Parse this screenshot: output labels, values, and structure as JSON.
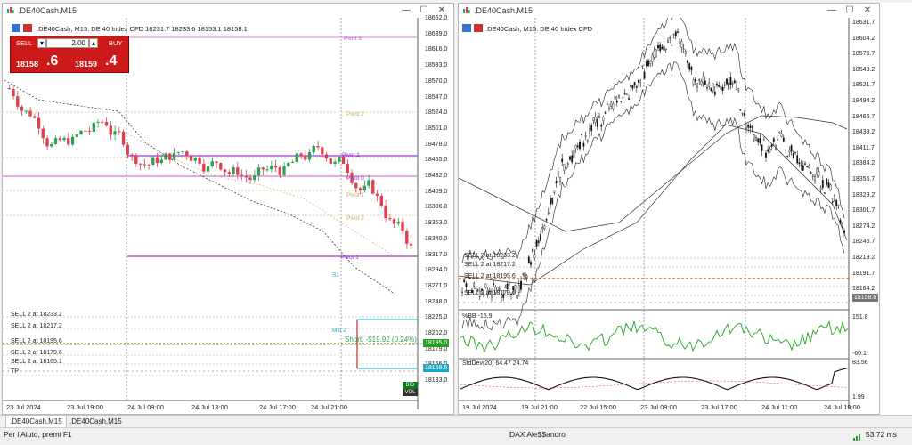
{
  "left_window": {
    "title": ".DE40Cash,M15",
    "chart_header": ".DE40Cash, M15:  DE 40 Index CFD  18231.7 18233.6 18153.1 18158.1",
    "trade_panel": {
      "sell_label": "SELL",
      "buy_label": "BUY",
      "volume": "2.00",
      "sell_price_main": "18158",
      "sell_price_big": ".6",
      "buy_price_main": "18159",
      "buy_price_big": ".4"
    },
    "price_axis": [
      "18662.0",
      "18639.0",
      "18616.0",
      "18593.0",
      "18570.0",
      "18547.0",
      "18524.0",
      "18501.0",
      "18478.0",
      "18455.0",
      "18432.0",
      "18409.0",
      "18386.0",
      "18363.0",
      "18340.0",
      "18317.0",
      "18294.0",
      "18271.0",
      "18248.0",
      "18225.0",
      "18202.0",
      "18179.0",
      "18156.0",
      "18133.0"
    ],
    "time_axis": [
      "23 Jul 2024",
      "23 Jul 19:00",
      "24 Jul 09:00",
      "24 Jul 13:00",
      "24 Jul 17:00",
      "24 Jul 21:00"
    ],
    "level_labels": [
      "Pivot 3",
      "Pivot 2",
      "Pivot 1",
      "Pivot 0",
      "Pivot 1",
      "Pivot 2",
      "Pivot 1",
      "S1",
      "Mid 2"
    ],
    "orders": [
      "SELL 2 at 18233.2",
      "SELL 2 at 18217.2",
      "SELL 2 at 18195.6",
      "SELL 2 at 18179.6",
      "SELL 2 at 18165.1",
      "TP"
    ],
    "short_text": "Short: -$19.92 (0.24%)",
    "price_box_green": "18195.0",
    "price_box_teal": "18158.6",
    "small_buttons": [
      "BID",
      "VOL"
    ]
  },
  "right_window": {
    "title": ".DE40Cash,M15",
    "chart_header": ".DE40Cash, M15:  DE 40 Index CFD",
    "price_axis": [
      "18631.7",
      "18604.2",
      "18576.7",
      "18549.2",
      "18521.7",
      "18494.2",
      "18466.7",
      "18439.2",
      "18411.7",
      "18384.2",
      "18356.7",
      "18329.2",
      "18301.7",
      "18274.2",
      "18246.7",
      "18219.2",
      "18191.7",
      "18164.2"
    ],
    "orders": [
      "SELL 2 at 18233.2",
      "SELL 2 at 18217.2",
      "SELL 2 at 18195.6",
      "SELL 2 at 18179.6"
    ],
    "price_box": "18158.6",
    "bb_header": "%BB -15.9",
    "bb_axis": [
      "151.8",
      "-60.1"
    ],
    "std_header": "StdDev(20) 64.47 24.74",
    "std_axis": [
      "83.56",
      "1.99"
    ],
    "time_axis": [
      "19 Jul 2024",
      "19 Jul 21:00",
      "22 Jul 15:00",
      "23 Jul 09:00",
      "23 Jul 17:00",
      "24 Jul 11:00",
      "24 Jul 19:00"
    ]
  },
  "tabs": [
    ".DE40Cash,M15",
    ".DE40Cash,M15"
  ],
  "status": {
    "help": "Per l'Aiuto, premi F1",
    "profile": "DAX Ale$$andro",
    "ping": "53.72 ms"
  },
  "colors": {
    "bull": "#2f9e57",
    "bear": "#e0404c",
    "green_bb": "#22a022",
    "purple": "#9a38d8",
    "magenta": "#cc55cc",
    "gold": "#c9a84a",
    "teal": "#1aa7c8"
  }
}
